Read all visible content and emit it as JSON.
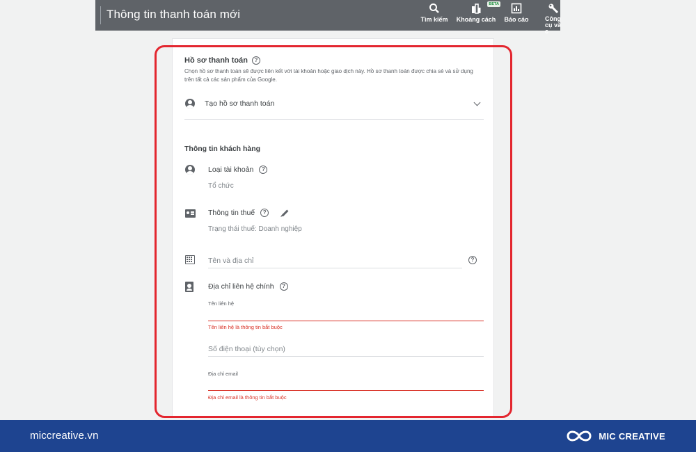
{
  "toolbar": {
    "title": "Thông tin thanh toán mới",
    "tools": [
      {
        "label": "Tìm kiếm",
        "icon": "search-icon"
      },
      {
        "label": "Khoảng cách",
        "icon": "gap-icon",
        "badge": "BETA"
      },
      {
        "label": "Báo cáo",
        "icon": "report-icon"
      },
      {
        "label": "Công cụ và c",
        "icon": "wrench-icon"
      }
    ]
  },
  "billing_profile": {
    "heading": "Hồ sơ thanh toán",
    "description": "Chọn hồ sơ thanh toán sẽ được liên kết với tài khoản hoặc giao dịch này. Hồ sơ thanh toán được chia sẻ và sử dụng trên tất cả các sản phẩm của Google.",
    "create_label": "Tạo hồ sơ thanh toán"
  },
  "customer_info": {
    "heading": "Thông tin khách hàng",
    "account_type_label": "Loại tài khoản",
    "account_type_value": "Tổ chức",
    "tax_info_label": "Thông tin thuế",
    "tax_status_value": "Trạng thái thuế: Doanh nghiệp",
    "name_address_placeholder": "Tên và địa chỉ",
    "primary_contact_label": "Địa chỉ liên hệ chính",
    "contact_name_label": "Tên liên hệ",
    "contact_name_error": "Tên liên hệ là thông tin bắt buộc",
    "phone_placeholder": "Số điện thoại (tùy chọn)",
    "email_label": "Địa chỉ email",
    "email_error": "Địa chỉ email là thông tin bắt buộc"
  },
  "footer": {
    "site": "miccreative.vn",
    "brand": "MIC CREATIVE"
  },
  "colors": {
    "toolbar_bg": "#5f6368",
    "highlight_outline": "#e3262f",
    "error": "#d93025",
    "footer_bg": "#1e4490"
  }
}
